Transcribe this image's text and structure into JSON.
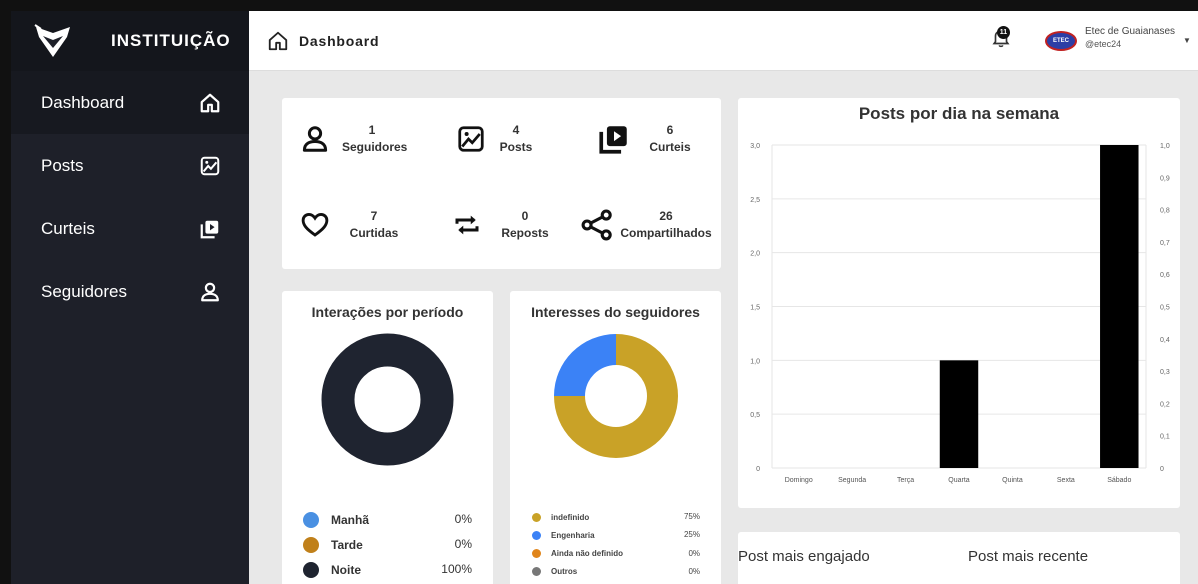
{
  "sidebar": {
    "brand": "INSTITUIÇÃO",
    "items": [
      {
        "label": "Dashboard",
        "icon": "home-icon"
      },
      {
        "label": "Posts",
        "icon": "image-icon"
      },
      {
        "label": "Curteis",
        "icon": "video-library-icon"
      },
      {
        "label": "Seguidores",
        "icon": "user-icon"
      }
    ]
  },
  "topbar": {
    "title": "Dashboard",
    "notification_count": "11",
    "avatar_text": "ETEC",
    "user_name": "Etec de Guaianases",
    "user_handle": "@etec24"
  },
  "stats": [
    {
      "value": "1",
      "label": "Seguidores",
      "icon": "user-icon"
    },
    {
      "value": "4",
      "label": "Posts",
      "icon": "image-icon"
    },
    {
      "value": "6",
      "label": "Curteis",
      "icon": "video-library-icon"
    },
    {
      "value": "7",
      "label": "Curtidas",
      "icon": "heart-icon"
    },
    {
      "value": "0",
      "label": "Reposts",
      "icon": "repost-icon"
    },
    {
      "value": "26",
      "label": "Compartilhados",
      "icon": "share-icon"
    }
  ],
  "interacoes": {
    "title": "Interações por período",
    "items": [
      {
        "label": "Manhã",
        "pct": "0%",
        "value": 0,
        "color": "#4a90e2"
      },
      {
        "label": "Tarde",
        "pct": "0%",
        "value": 0,
        "color": "#c0801a"
      },
      {
        "label": "Noite",
        "pct": "100%",
        "value": 100,
        "color": "#1f2430"
      }
    ]
  },
  "interesses": {
    "title": "Interesses do seguidores",
    "items": [
      {
        "label": "indefinido",
        "pct": "75%",
        "value": 75,
        "color": "#c9a227"
      },
      {
        "label": "Engenharia",
        "pct": "25%",
        "value": 25,
        "color": "#3b82f6"
      },
      {
        "label": "Ainda não definido",
        "pct": "0%",
        "value": 0,
        "color": "#e0851b"
      },
      {
        "label": "Outros",
        "pct": "0%",
        "value": 0,
        "color": "#777777"
      }
    ]
  },
  "chart_data": {
    "type": "bar",
    "title": "Posts por dia na semana",
    "categories": [
      "Domingo",
      "Segunda",
      "Terça",
      "Quarta",
      "Quinta",
      "Sexta",
      "Sábado"
    ],
    "values": [
      0,
      0,
      0,
      1,
      0,
      0,
      3
    ],
    "ylim": [
      0,
      3
    ],
    "yticks": [
      "0",
      "0,5",
      "1,0",
      "1,5",
      "2,0",
      "2,5",
      "3,0"
    ],
    "y2ticks": [
      "0",
      "0,1",
      "0,2",
      "0,3",
      "0,4",
      "0,5",
      "0,6",
      "0,7",
      "0,8",
      "0,9",
      "1,0"
    ],
    "bar_color": "#000000",
    "grid": "horizontal"
  },
  "bottom": {
    "engajado": "Post mais engajado",
    "recente": "Post mais recente"
  }
}
